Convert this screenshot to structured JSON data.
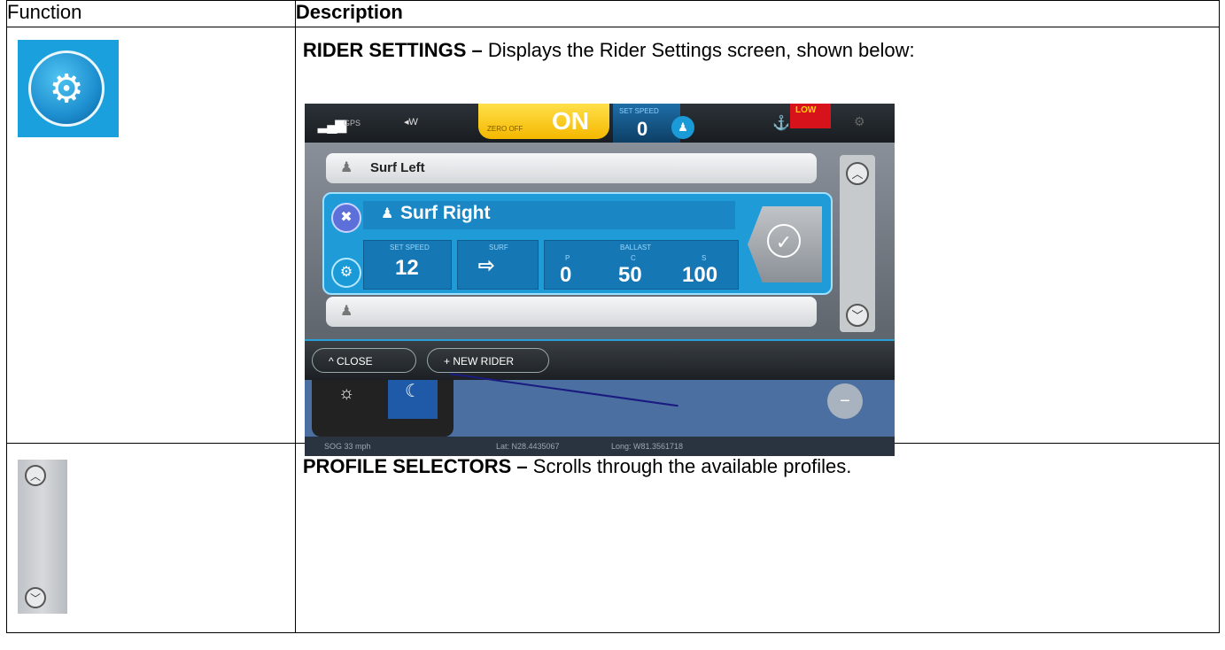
{
  "table": {
    "header": {
      "function": "Function",
      "description": "Description"
    },
    "rows": [
      {
        "title": "RIDER SETTINGS –",
        "text": " Displays the Rider Settings screen, shown below:",
        "icon": "gear-icon"
      },
      {
        "title": "PROFILE SELECTORS –",
        "text": " Scrolls through the available profiles.",
        "icon": "scroll-selector-icon"
      }
    ]
  },
  "screen": {
    "topbar": {
      "gps": "GPS",
      "wind": "◂W",
      "zero_off": "ZERO OFF",
      "on": "ON",
      "set_speed_label": "SET SPEED",
      "set_speed_value": "0",
      "low": "LOW"
    },
    "profiles": [
      {
        "name": "Surf Left"
      },
      {
        "name": "Surf Right"
      },
      {
        "name": ""
      }
    ],
    "selected": {
      "set_speed_label": "SET SPEED",
      "set_speed": "12",
      "surf_label": "SURF",
      "ballast_label": "BALLAST",
      "p_label": "P",
      "p_value": "0",
      "c_label": "C",
      "c_value": "50",
      "s_label": "S",
      "s_value": "100"
    },
    "buttons": {
      "close": "^  CLOSE",
      "new_rider": "+  NEW RIDER"
    },
    "map": {
      "sog": "SOG   33 mph",
      "lat": "Lat: N28.4435067",
      "long": "Long: W81.3561718",
      "minus": "−"
    }
  },
  "colors": {
    "accent": "#1f9bd8",
    "on_yellow": "#f5b800",
    "low_red": "#d8121a"
  }
}
